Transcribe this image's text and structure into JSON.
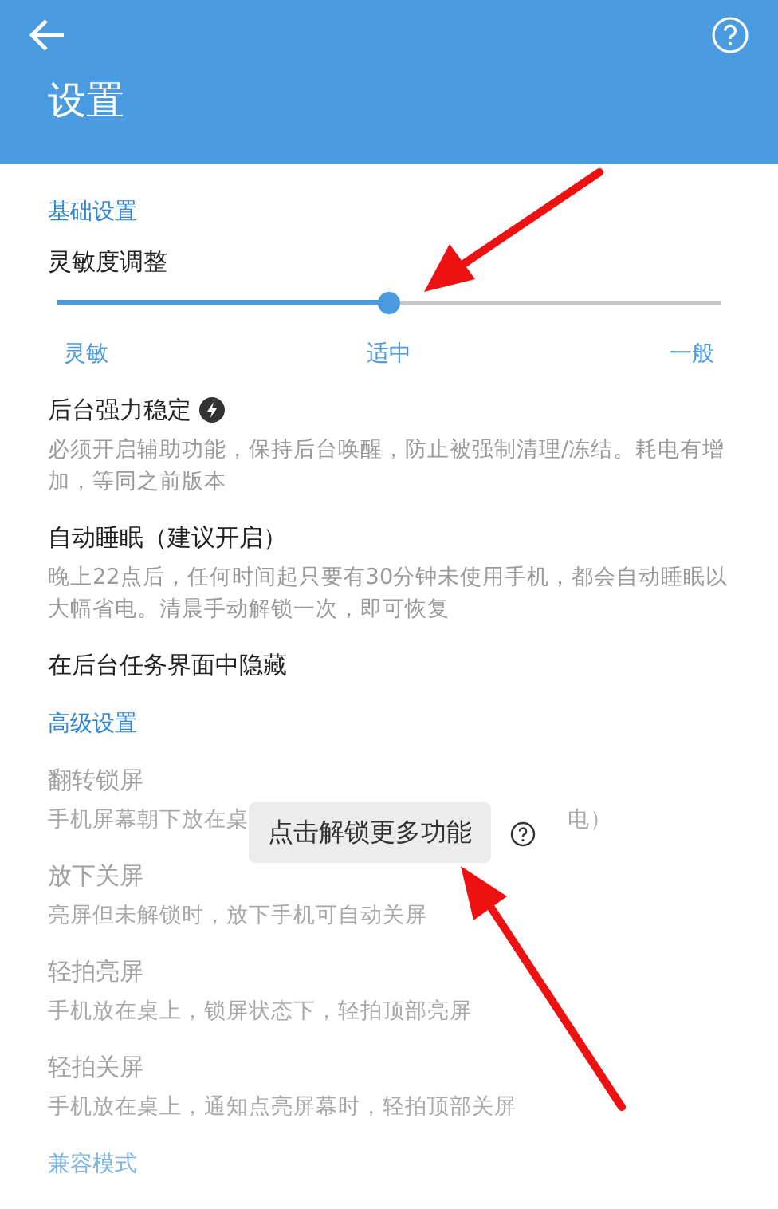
{
  "header": {
    "title": "设置"
  },
  "sections": [
    {
      "title": "基础设置",
      "disabled": false,
      "items": [
        {
          "kind": "slider",
          "title": "灵敏度调整",
          "level": 0.5,
          "labels": [
            "灵敏",
            "适中",
            "一般"
          ]
        },
        {
          "kind": "text",
          "title": "后台强力稳定",
          "bolt": true,
          "disabled": false,
          "description": "必须开启辅助功能，保持后台唤醒，防止被强制清理/冻结。耗电有增加，等同之前版本"
        },
        {
          "kind": "text",
          "title": "自动睡眠（建议开启）",
          "disabled": false,
          "description": "晚上22点后，任何时间起只要有30分钟未使用手机，都会自动睡眠以大幅省电。清晨手动解锁一次，即可恢复"
        },
        {
          "kind": "text",
          "title": "在后台任务界面中隐藏",
          "disabled": false
        }
      ]
    },
    {
      "title": "高级设置",
      "disabled": false,
      "items": [
        {
          "kind": "text",
          "title": "翻转锁屏",
          "disabled": true,
          "description_parts": [
            "手机屏幕朝下放在桌",
            "电）"
          ]
        },
        {
          "kind": "text",
          "title": "放下关屏",
          "disabled": true,
          "description": "亮屏但未解锁时，放下手机可自动关屏"
        },
        {
          "kind": "text",
          "title": "轻拍亮屏",
          "disabled": true,
          "description": "手机放在桌上，锁屏状态下，轻拍顶部亮屏"
        },
        {
          "kind": "text",
          "title": "轻拍关屏",
          "disabled": true,
          "description": "手机放在桌上，通知点亮屏幕时，轻拍顶部关屏"
        }
      ]
    },
    {
      "title": "兼容模式",
      "disabled": true
    }
  ],
  "toast": {
    "text": "点击解锁更多功能"
  }
}
